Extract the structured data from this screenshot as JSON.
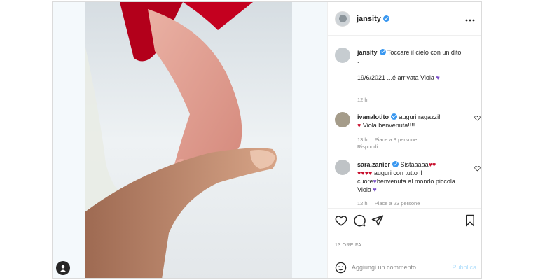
{
  "post": {
    "username": "jansity",
    "caption_lines": [
      "Toccare il cielo con un dito",
      ".",
      ".",
      "19/6/2021 ...é arrivata Viola"
    ],
    "caption_time": "12 h"
  },
  "comments": [
    {
      "username": "ivanalotito",
      "text_a": "auguri ragazzi!",
      "text_b": "Viola benvenuta!!!!",
      "time": "13 h",
      "likes": "Piace a 8 persone",
      "reply": "Rispondi"
    },
    {
      "username": "sara.zanier",
      "text_a": "Sistaaaaa",
      "text_b": "auguri con tutto il cuore",
      "text_c": "benvenuta al mondo piccola Viola",
      "time": "12 h",
      "likes": "Piace a 23 persone"
    }
  ],
  "post_time": "13 ORE FA",
  "comment_box": {
    "placeholder": "Aggiungi un commento...",
    "post_label": "Pubblica"
  },
  "colors": {
    "verified": "#3897f0",
    "heart_red": "#c8102e",
    "heart_purple": "#7b4fc9",
    "post_button": "#b2dffc"
  },
  "icons": [
    "more-options-icon",
    "like-icon",
    "comment-icon",
    "share-icon",
    "save-icon",
    "emoji-icon",
    "user-tag-icon",
    "verified-badge-icon"
  ]
}
